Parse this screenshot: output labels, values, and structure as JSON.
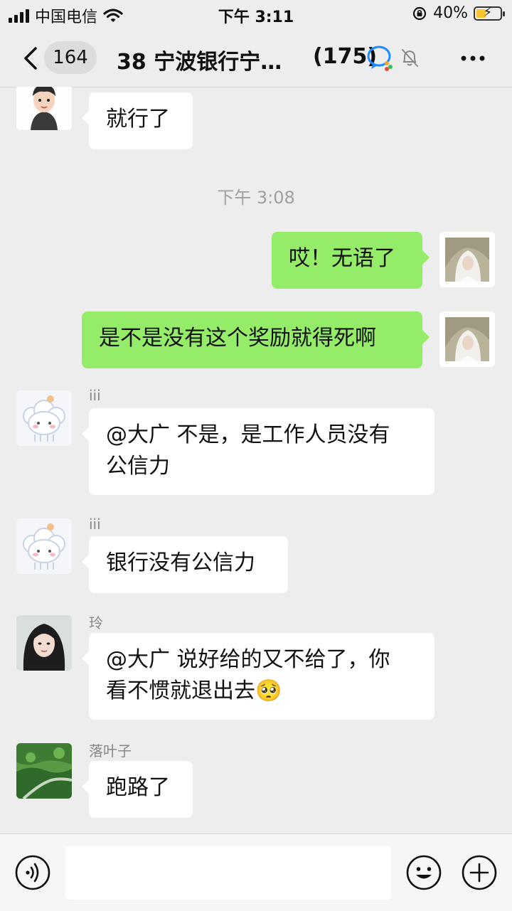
{
  "status_bar": {
    "carrier": "中国电信",
    "time": "下午 3:11",
    "battery": "40%",
    "battery_level": 0.4
  },
  "nav": {
    "unread_count": "164",
    "title": "38 宁波银行宁…",
    "member_count": "(175)"
  },
  "chat": {
    "timestamp": "下午 3:08",
    "messages": [
      {
        "sender": "",
        "text": "就行了"
      },
      {
        "sender": "",
        "text": "哎！无语了"
      },
      {
        "sender": "",
        "text": "是不是没有这个奖励就得死啊"
      },
      {
        "sender": "iii",
        "line1": "@大广 不是，是工作人员没有",
        "line2": "公信力"
      },
      {
        "sender": "iii",
        "text": "银行没有公信力"
      },
      {
        "sender": "玲",
        "line1": "@大广 说好给的又不给了，你",
        "line2": "看不惯就退出去🥺"
      },
      {
        "sender": "落叶子",
        "text": "跑路了"
      }
    ]
  },
  "input": {
    "placeholder": ""
  },
  "colors": {
    "bubble_out": "#95ec69",
    "bubble_in": "#ffffff",
    "background": "#ededed"
  }
}
